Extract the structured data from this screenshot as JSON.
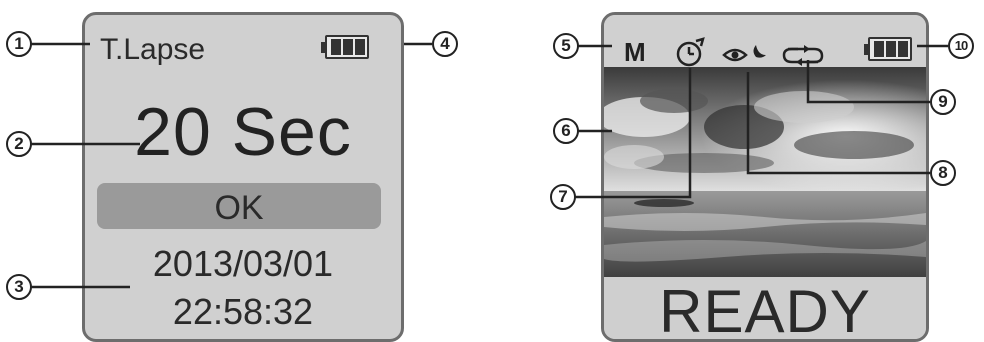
{
  "left_screen": {
    "mode_label": "T.Lapse",
    "interval_value": "20 Sec",
    "ok_label": "OK",
    "date": "2013/03/01",
    "time": "22:58:32",
    "icons": [
      "battery-icon"
    ]
  },
  "right_screen": {
    "mode_label": "M",
    "status_label": "READY",
    "icons": [
      "timer-icon",
      "eye-night-icon",
      "loop-icon",
      "battery-icon"
    ]
  },
  "callouts": {
    "c1": "1",
    "c2": "2",
    "c3": "3",
    "c4": "4",
    "c5": "5",
    "c6": "6",
    "c7": "7",
    "c8": "8",
    "c9": "9",
    "c10": "10"
  },
  "colors": {
    "screen_bg": "#d0d0d0",
    "screen_border": "#6d6d6d",
    "ok_bar": "#9a9a9a",
    "text": "#222222"
  }
}
